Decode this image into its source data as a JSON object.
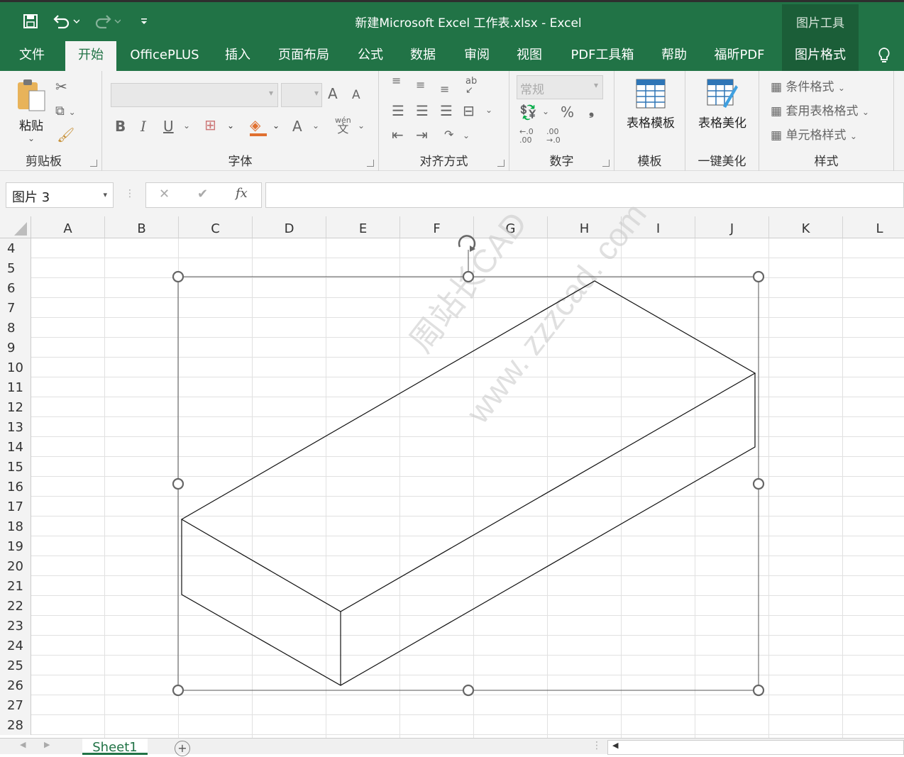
{
  "window": {
    "title": "新建Microsoft Excel 工作表.xlsx  -  Excel",
    "context_tool": "图片工具"
  },
  "tabs": [
    {
      "label": "文件"
    },
    {
      "label": "开始"
    },
    {
      "label": "OfficePLUS"
    },
    {
      "label": "插入"
    },
    {
      "label": "页面布局"
    },
    {
      "label": "公式"
    },
    {
      "label": "数据"
    },
    {
      "label": "审阅"
    },
    {
      "label": "视图"
    },
    {
      "label": "PDF工具箱"
    },
    {
      "label": "帮助"
    },
    {
      "label": "福昕PDF"
    },
    {
      "label": "图片格式"
    }
  ],
  "ribbon": {
    "clipboard": {
      "paste": "粘贴",
      "label": "剪贴板"
    },
    "font": {
      "label": "字体",
      "bold": "B",
      "italic": "I",
      "underline": "U",
      "grow": "A",
      "shrink": "A",
      "color": "A",
      "phonetic": "wén",
      "phonetic_char": "文"
    },
    "align": {
      "label": "对齐方式",
      "orient": "ab"
    },
    "number": {
      "label": "数字",
      "format": "常规",
      "percent": "%",
      "comma": "❟",
      "inc": "←.0 .00",
      "dec": ".00 →.0"
    },
    "template": {
      "button": "表格模板",
      "label": "模板"
    },
    "beautify": {
      "button": "表格美化",
      "label": "一键美化"
    },
    "styles": {
      "label": "样式",
      "cond": "条件格式",
      "table": "套用表格格式",
      "cell": "单元格样式"
    }
  },
  "namebox": {
    "value": "图片 3"
  },
  "fx": {
    "cancel": "✕",
    "enter": "✔",
    "fx": "fx"
  },
  "columns": [
    "A",
    "B",
    "C",
    "D",
    "E",
    "F",
    "G",
    "H",
    "I",
    "J",
    "K",
    "L"
  ],
  "rows": [
    "4",
    "5",
    "6",
    "7",
    "8",
    "9",
    "10",
    "11",
    "12",
    "13",
    "14",
    "15",
    "16",
    "17",
    "18",
    "19",
    "20",
    "21",
    "22",
    "23",
    "24",
    "25",
    "26",
    "27",
    "28"
  ],
  "watermark": {
    "line1": "周站长CAD",
    "line2": "www. zzzcad. com"
  },
  "sheet": {
    "name": "Sheet1",
    "add": "+"
  }
}
